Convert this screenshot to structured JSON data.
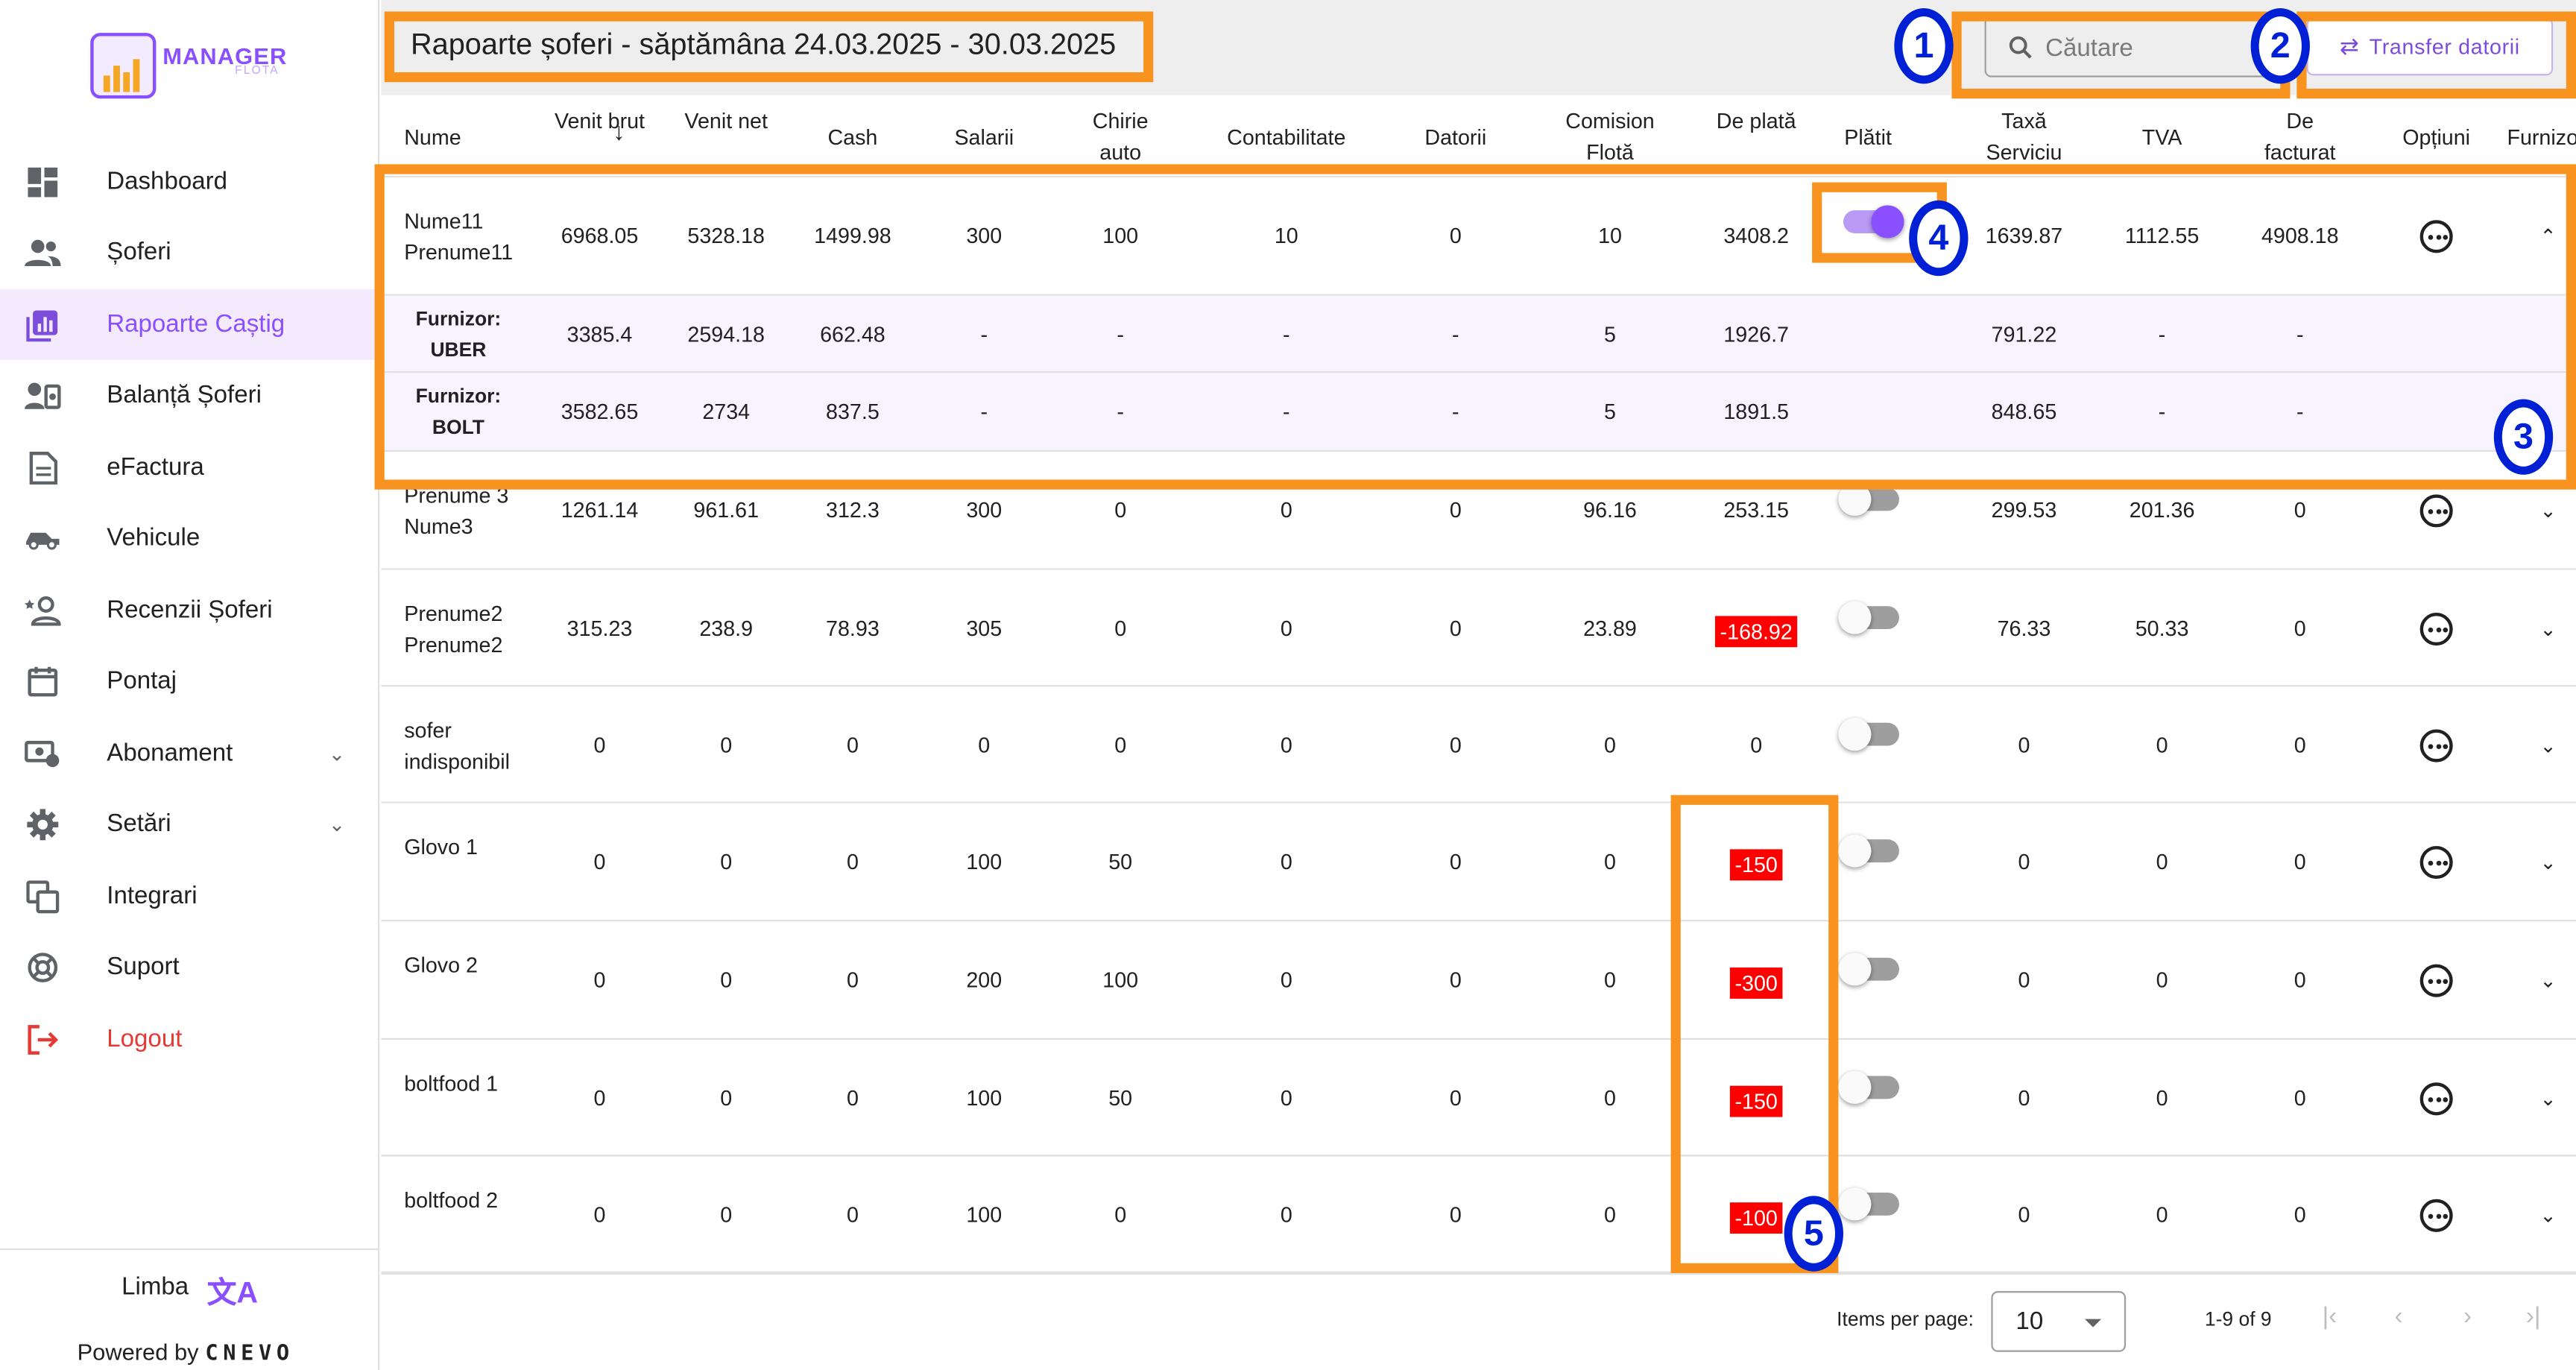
{
  "brand": {
    "name": "MANAGER",
    "sub": "FLOTA"
  },
  "sidebar": {
    "items": [
      {
        "label": "Dashboard",
        "icon": "dashboard-icon"
      },
      {
        "label": "Șoferi",
        "icon": "people-icon"
      },
      {
        "label": "Rapoarte Caștig",
        "icon": "report-icon",
        "active": true
      },
      {
        "label": "Balanță Șoferi",
        "icon": "balance-icon"
      },
      {
        "label": "eFactura",
        "icon": "document-icon"
      },
      {
        "label": "Vehicule",
        "icon": "vehicle-icon"
      },
      {
        "label": "Recenzii Șoferi",
        "icon": "review-icon"
      },
      {
        "label": "Pontaj",
        "icon": "calendar-icon"
      },
      {
        "label": "Abonament",
        "icon": "subscription-icon",
        "expandable": true
      },
      {
        "label": "Setări",
        "icon": "gear-icon",
        "expandable": true
      },
      {
        "label": "Integrari",
        "icon": "integrations-icon"
      },
      {
        "label": "Suport",
        "icon": "support-icon"
      },
      {
        "label": "Logout",
        "icon": "logout-icon"
      }
    ],
    "footer": {
      "language_label": "Limba",
      "powered_by": "Powered by",
      "powered_brand": "CNEVO"
    }
  },
  "header": {
    "title": "Rapoarte șoferi - săptămâna 24.03.2025 - 30.03.2025",
    "search_placeholder": "Căutare",
    "transfer_label": "Transfer datorii"
  },
  "table": {
    "columns": [
      {
        "key": "nume",
        "label": "Nume"
      },
      {
        "key": "venit_brut",
        "label": "Venit brut",
        "sorted": "desc"
      },
      {
        "key": "venit_net",
        "label": "Venit net"
      },
      {
        "key": "cash",
        "label": "Cash"
      },
      {
        "key": "salarii",
        "label": "Salarii"
      },
      {
        "key": "chirie",
        "label": "Chirie auto"
      },
      {
        "key": "contabilitate",
        "label": "Contabilitate"
      },
      {
        "key": "datorii",
        "label": "Datorii"
      },
      {
        "key": "comision",
        "label": "Comision Flotă"
      },
      {
        "key": "de_plata",
        "label": "De plată"
      },
      {
        "key": "platit",
        "label": "Plătit"
      },
      {
        "key": "taxa",
        "label": "Taxă Serviciu"
      },
      {
        "key": "tva",
        "label": "TVA"
      },
      {
        "key": "de_facturat",
        "label": "De facturat"
      },
      {
        "key": "optiuni",
        "label": "Opțiuni"
      },
      {
        "key": "furnizor",
        "label": "Furnizo"
      }
    ],
    "rows": [
      {
        "name": "Nume11 Prenume11",
        "values": [
          "6968.05",
          "5328.18",
          "1499.98",
          "300",
          "100",
          "10",
          "0",
          "10",
          "3408.2",
          "1639.87",
          "1112.55",
          "4908.18"
        ],
        "paid": true,
        "expanded": true
      },
      {
        "name": "Furnizor: UBER",
        "supplier": true,
        "values": [
          "3385.4",
          "2594.18",
          "662.48",
          "-",
          "-",
          "-",
          "-",
          "5",
          "1926.7",
          "791.22",
          "-",
          "-"
        ]
      },
      {
        "name": "Furnizor: BOLT",
        "supplier": true,
        "values": [
          "3582.65",
          "2734",
          "837.5",
          "-",
          "-",
          "-",
          "-",
          "5",
          "1891.5",
          "848.65",
          "-",
          "-"
        ]
      },
      {
        "name": "Prenume 3 Nume3",
        "values": [
          "1261.14",
          "961.61",
          "312.3",
          "300",
          "0",
          "0",
          "0",
          "96.16",
          "253.15",
          "299.53",
          "201.36",
          "0"
        ],
        "paid": false
      },
      {
        "name": "Prenume2 Prenume2",
        "values": [
          "315.23",
          "238.9",
          "78.93",
          "305",
          "0",
          "0",
          "0",
          "23.89",
          "-168.92",
          "76.33",
          "50.33",
          "0"
        ],
        "paid": false
      },
      {
        "name": "sofer indisponibil",
        "values": [
          "0",
          "0",
          "0",
          "0",
          "0",
          "0",
          "0",
          "0",
          "0",
          "0",
          "0",
          "0"
        ],
        "paid": false
      },
      {
        "name": "Glovo 1",
        "values": [
          "0",
          "0",
          "0",
          "100",
          "50",
          "0",
          "0",
          "0",
          "-150",
          "0",
          "0",
          "0"
        ],
        "paid": false
      },
      {
        "name": "Glovo 2",
        "values": [
          "0",
          "0",
          "0",
          "200",
          "100",
          "0",
          "0",
          "0",
          "-300",
          "0",
          "0",
          "0"
        ],
        "paid": false
      },
      {
        "name": "boltfood 1",
        "values": [
          "0",
          "0",
          "0",
          "100",
          "50",
          "0",
          "0",
          "0",
          "-150",
          "0",
          "0",
          "0"
        ],
        "paid": false
      },
      {
        "name": "boltfood 2",
        "values": [
          "0",
          "0",
          "0",
          "100",
          "0",
          "0",
          "0",
          "0",
          "-100",
          "0",
          "0",
          "0"
        ],
        "paid": false
      }
    ]
  },
  "paginator": {
    "items_per_page_label": "Items per page:",
    "page_size": "10",
    "range": "1-9 of 9"
  },
  "annotations": [
    "1",
    "2",
    "3",
    "4",
    "5"
  ],
  "colors": {
    "accent": "#8a4fff",
    "highlight": "#f7931e",
    "badge": "#0020d6",
    "negative": "#ff0000"
  }
}
